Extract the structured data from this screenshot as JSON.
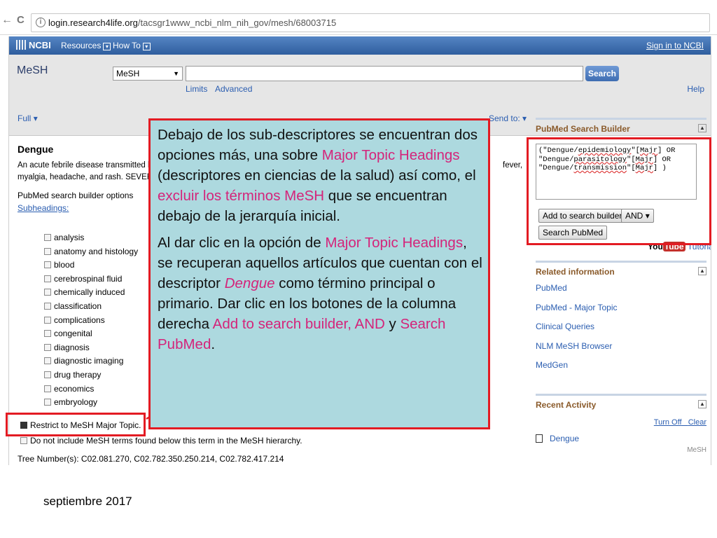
{
  "browser": {
    "back": "←",
    "reload": "C",
    "url_host": "login.research4life.org",
    "url_path": "/tacsgr1www_ncbi_nlm_nih_gov/mesh/68003715"
  },
  "topbar": {
    "logo": "NCBI",
    "resources": "Resources",
    "howto": "How To",
    "signin": "Sign in to NCBI"
  },
  "search": {
    "db_title": "MeSH",
    "db_selected": "MeSH",
    "button": "Search",
    "limits": "Limits",
    "advanced": "Advanced",
    "help": "Help"
  },
  "content": {
    "full": "Full",
    "send_to": "Send to:",
    "term": "Dengue",
    "definition_line1": "An acute febrile disease transmitted by",
    "definition_line2": "myalgia, headache, and rash. SEVERE",
    "definition_tail": "fever,",
    "builder_options": "PubMed search builder options",
    "subheadings": "Subheadings:",
    "subheading_list": [
      "analysis",
      "anatomy and histology",
      "blood",
      "cerebrospinal fluid",
      "chemically induced",
      "classification",
      "complications",
      "congenital",
      "diagnosis",
      "diagnostic imaging",
      "drug therapy",
      "economics",
      "embryology"
    ],
    "restrict": "Restrict to MeSH Major Topic.",
    "do_not_include": "Do not include MeSH terms found below this term in the MeSH hierarchy.",
    "tree_numbers": "Tree Number(s): C02.081.270, C02.782.350.250.214, C02.782.417.214"
  },
  "builder": {
    "title": "PubMed Search Builder",
    "query_lines": [
      [
        "(\"Dengue/",
        "epidemiology",
        "\"[",
        "Majr",
        "] OR"
      ],
      [
        "\"Dengue/",
        "parasitology",
        "\"[",
        "Majr",
        "] OR"
      ],
      [
        "\"Dengue/",
        "transmission",
        "\"[",
        "Majr",
        "] )"
      ]
    ],
    "add_button": "Add to search builder",
    "operator": "AND",
    "search_button": "Search PubMed",
    "youtube_you": "You",
    "youtube_tube": "Tube",
    "tutorial": "Tutorial"
  },
  "related": {
    "title": "Related information",
    "items": [
      "PubMed",
      "PubMed - Major Topic",
      "Clinical Queries",
      "NLM MeSH Browser",
      "MedGen"
    ]
  },
  "recent": {
    "title": "Recent Activity",
    "turn_off": "Turn Off",
    "clear": "Clear",
    "item": "Dengue",
    "item_db": "MeSH"
  },
  "callout": {
    "p1_a": "Debajo de los sub-descriptores se encuentran dos opciones más, una sobre ",
    "p1_hl1": "Major Topic Headings",
    "p1_b": " (descriptores en ciencias de la salud) así como, el ",
    "p1_hl2": "excluir los términos MeSH",
    "p1_c": " que se encuentran debajo de la jerarquía inicial.",
    "p2_a": "Al dar clic en la opción de ",
    "p2_hl1": "Major Topic Headings",
    "p2_b": ", se recuperan aquellos artículos que cuentan con el descriptor ",
    "p2_em": "Dengue",
    "p2_c": " como término principal o primario. Dar clic en los botones de la columna derecha ",
    "p2_hl2": "Add to search builder, AND",
    "p2_d": " y ",
    "p2_hl3": "Search PubMed",
    "p2_e": "."
  },
  "colors": {
    "annotation_border": "#e31b23",
    "callout_bg": "#add9df",
    "highlight": "#d4247a",
    "ncbi_blue": "#3d6eb0"
  },
  "footer": {
    "date": "septiembre 2017"
  }
}
